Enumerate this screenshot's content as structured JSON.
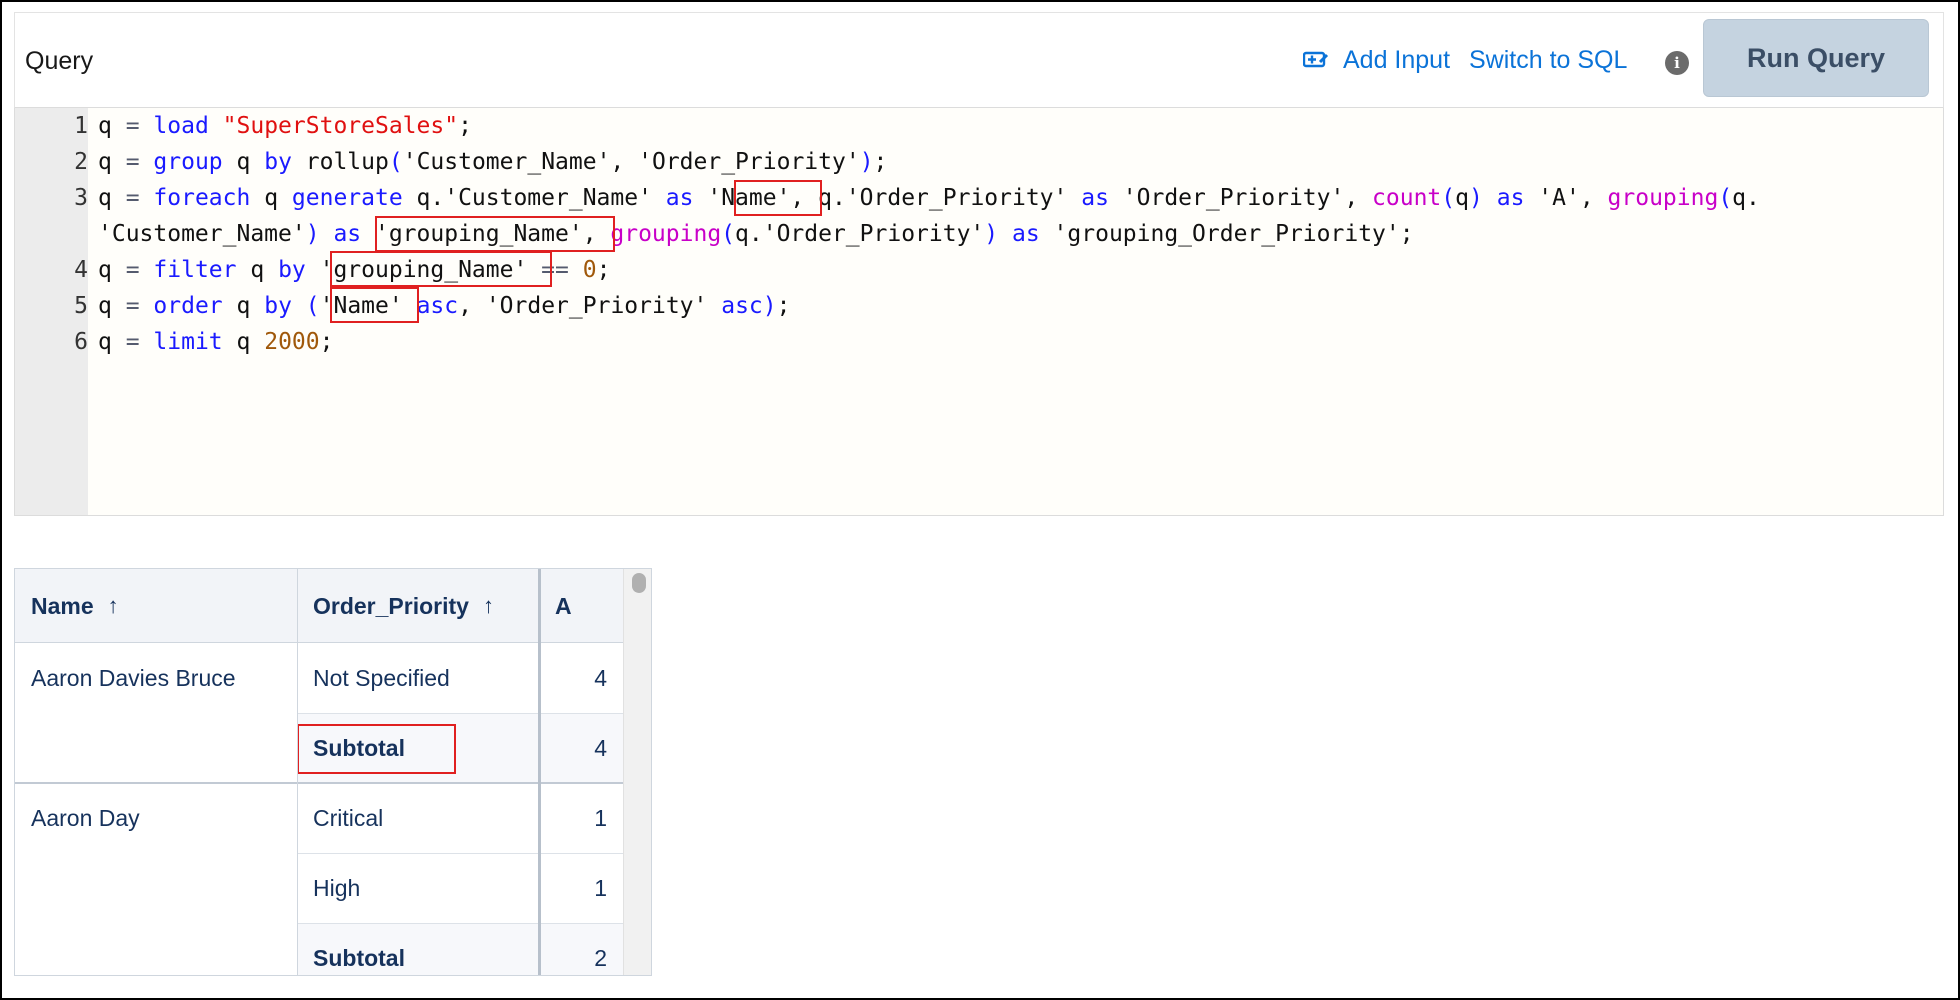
{
  "header": {
    "title": "Query",
    "add_input_label": "Add Input",
    "switch_label": "Switch to SQL",
    "run_label": "Run Query"
  },
  "editor": {
    "line_numbers": [
      "1",
      "2",
      "3",
      "",
      "4",
      "5",
      "6"
    ],
    "lines": [
      "q = load \"SuperStoreSales\";",
      "q = group q by rollup('Customer_Name', 'Order_Priority');",
      "q = foreach q generate q.'Customer_Name' as 'Name', q.'Order_Priority' as 'Order_Priority', count(q) as 'A', grouping(q.",
      "'Customer_Name') as 'grouping_Name', grouping(q.'Order_Priority') as 'grouping_Order_Priority';",
      "q = filter q by 'grouping_Name' == 0;",
      "q = order q by ('Name' asc, 'Order_Priority' asc);",
      "q = limit q 2000;"
    ]
  },
  "table": {
    "columns": [
      {
        "label": "Name",
        "sort": "↑"
      },
      {
        "label": "Order_Priority",
        "sort": "↑"
      },
      {
        "label": "A",
        "sort": ""
      }
    ],
    "groups": [
      {
        "name": "Aaron Davies Bruce",
        "rows": [
          {
            "priority": "Not Specified",
            "a": "4"
          },
          {
            "priority": "Subtotal",
            "a": "4"
          }
        ]
      },
      {
        "name": "Aaron Day",
        "rows": [
          {
            "priority": "Critical",
            "a": "1"
          },
          {
            "priority": "High",
            "a": "1"
          },
          {
            "priority": "Subtotal",
            "a": "2"
          }
        ]
      }
    ]
  },
  "colors": {
    "link": "#0b73d8",
    "keyword": "#1a1aff",
    "function": "#c800c8",
    "string": "#e01010",
    "number": "#a0580a",
    "highlight": "#e02020",
    "run_button": "#c5d3e0"
  }
}
